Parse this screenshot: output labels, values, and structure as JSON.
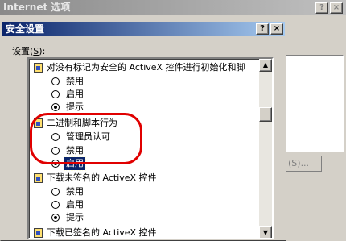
{
  "outer": {
    "title": "Internet 选项",
    "button_label": "(S)..."
  },
  "dialog": {
    "title": "安全设置",
    "help_btn": "?",
    "close_btn": "×",
    "settings_label_pre": "设置(",
    "settings_label_key": "S",
    "settings_label_post": "):"
  },
  "list": {
    "cat1": {
      "label": "对没有标记为安全的 ActiveX 控件进行初始化和脚",
      "options": [
        "禁用",
        "启用",
        "提示"
      ],
      "selected": 2
    },
    "cat2": {
      "label": "二进制和脚本行为",
      "options": [
        "管理员认可",
        "禁用",
        "启用"
      ],
      "selected": 2
    },
    "cat3": {
      "label": "下载未签名的 ActiveX 控件",
      "options": [
        "禁用",
        "启用",
        "提示"
      ],
      "selected": 2
    },
    "cat4": {
      "label": "下载已签名的 ActiveX 控件"
    }
  },
  "scrollbar": {
    "up": "▲",
    "down": "▼"
  },
  "titlebar_buttons": {
    "help": "?",
    "close": "×"
  }
}
